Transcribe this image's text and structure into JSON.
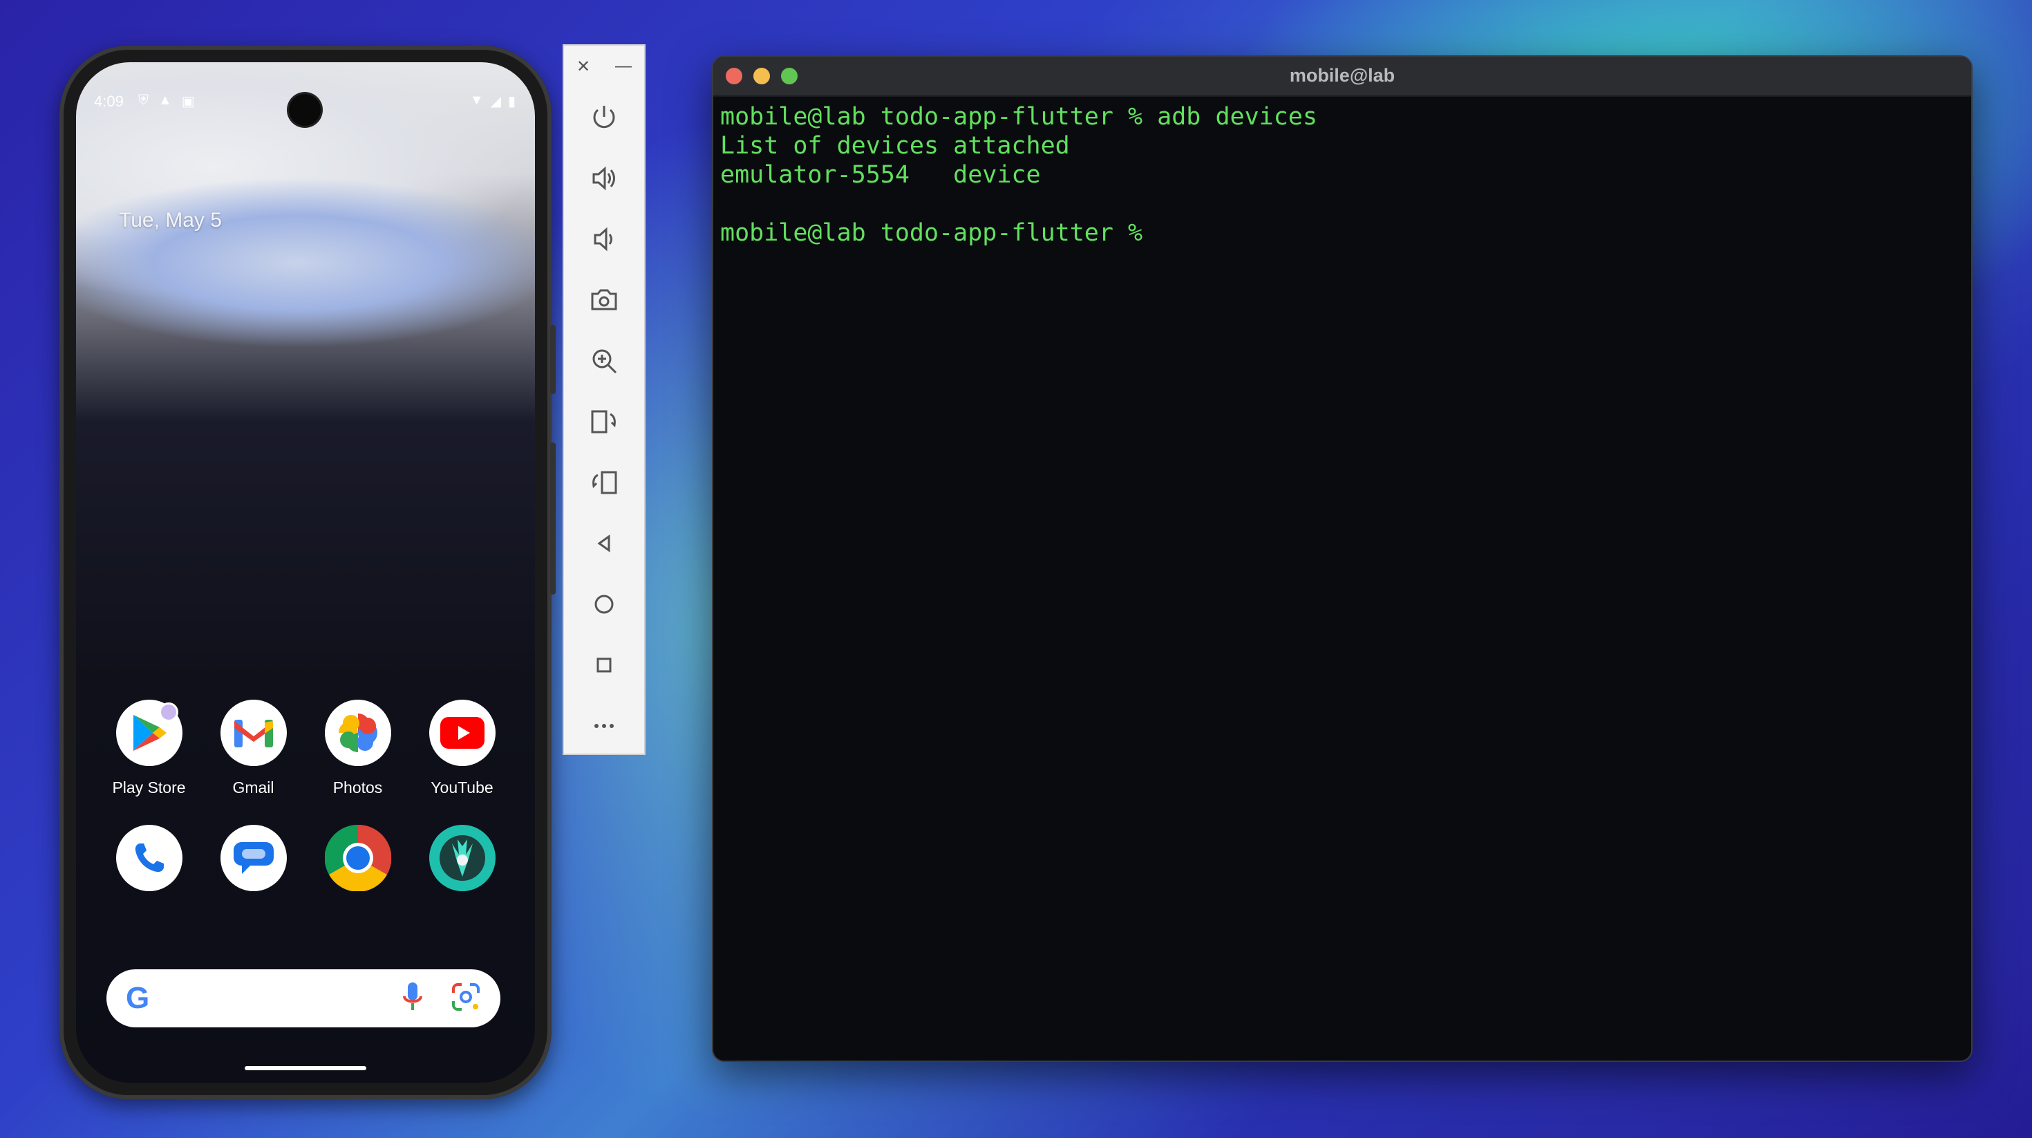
{
  "phone": {
    "status_time": "4:09",
    "status_left_icons": [
      "shield-icon",
      "warning-icon",
      "sim-icon"
    ],
    "status_right_icons": [
      "wifi-icon",
      "signal-icon",
      "battery-icon"
    ],
    "date": "Tue, May 5",
    "apps": [
      {
        "label": "Play Store",
        "icon": "play-store-icon"
      },
      {
        "label": "Gmail",
        "icon": "gmail-icon"
      },
      {
        "label": "Photos",
        "icon": "photos-icon"
      },
      {
        "label": "YouTube",
        "icon": "youtube-icon"
      },
      {
        "label": "",
        "icon": "phone-icon"
      },
      {
        "label": "",
        "icon": "messages-icon"
      },
      {
        "label": "",
        "icon": "chrome-icon"
      },
      {
        "label": "",
        "icon": "magisk-icon"
      }
    ],
    "search": {
      "logo": "G"
    }
  },
  "toolbar": {
    "close": "✕",
    "minimize": "—",
    "items": [
      "power-icon",
      "volume-up-icon",
      "volume-down-icon",
      "camera-icon",
      "zoom-icon",
      "rotate-left-icon",
      "rotate-right-icon",
      "back-icon",
      "home-icon",
      "overview-icon",
      "more-icon"
    ]
  },
  "terminal": {
    "title": "mobile@lab",
    "lines": [
      "mobile@lab todo-app-flutter % adb devices",
      "List of devices attached",
      "emulator-5554   device",
      "",
      "mobile@lab todo-app-flutter % "
    ],
    "colors": {
      "text": "#62e05e",
      "close": "#ec6a5e",
      "minimize": "#f4bf4f",
      "zoom": "#61c554"
    }
  }
}
